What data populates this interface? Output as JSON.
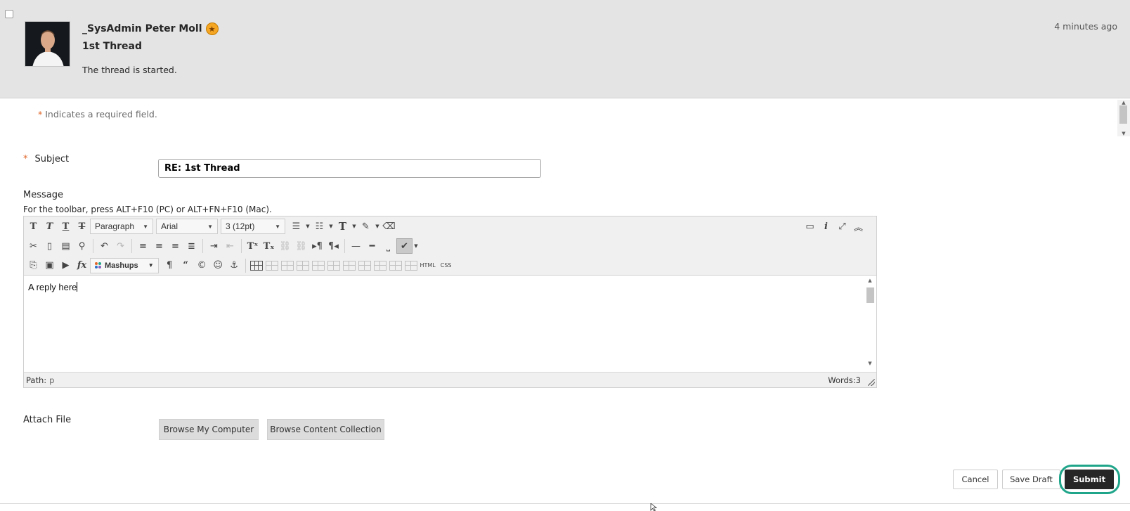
{
  "post": {
    "author": "_SysAdmin Peter Moll",
    "title": "1st Thread",
    "body": "The thread is started.",
    "timestamp": "4 minutes ago",
    "badge_icon": "star-badge-icon",
    "badge_color": "#f5a623"
  },
  "form": {
    "required_star": "*",
    "required_note": "Indicates a required field.",
    "subject_label": "Subject",
    "subject_value": "RE: 1st Thread",
    "message_label": "Message",
    "toolbar_hint": "For the toolbar, press ALT+F10 (PC) or ALT+FN+F10 (Mac).",
    "attach_label": "Attach File",
    "browse_computer": "Browse My Computer",
    "browse_collection": "Browse Content Collection"
  },
  "editor": {
    "format_select": "Paragraph",
    "font_select": "Arial",
    "size_select": "3 (12pt)",
    "mashups_label": "Mashups",
    "html_label": "HTML",
    "css_label": "CSS",
    "content": "A reply here",
    "path_label": "Path:",
    "path_value": "p",
    "words": "Words:3"
  },
  "actions": {
    "cancel": "Cancel",
    "save_draft": "Save Draft",
    "submit": "Submit"
  },
  "colors": {
    "header_bg": "#e4e4e4",
    "required": "#e0682b",
    "submit_bg": "#262626",
    "submit_ring": "#1fa58a"
  }
}
